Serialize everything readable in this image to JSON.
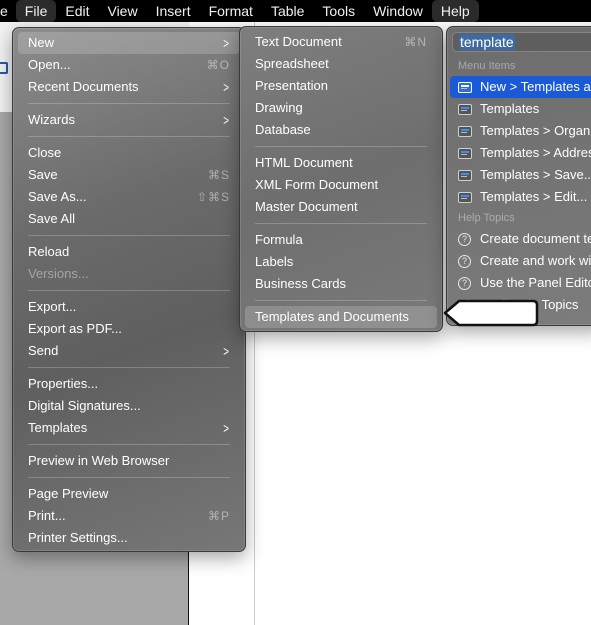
{
  "menubar": {
    "items": [
      {
        "label": "e",
        "open": false
      },
      {
        "label": "File",
        "open": true
      },
      {
        "label": "Edit",
        "open": false
      },
      {
        "label": "View",
        "open": false
      },
      {
        "label": "Insert",
        "open": false
      },
      {
        "label": "Format",
        "open": false
      },
      {
        "label": "Table",
        "open": false
      },
      {
        "label": "Tools",
        "open": false
      },
      {
        "label": "Window",
        "open": false
      },
      {
        "label": "Help",
        "open": true
      }
    ]
  },
  "file_menu": {
    "items": [
      {
        "label": "New",
        "submenu": true,
        "highlighted": true
      },
      {
        "label": "Open...",
        "shortcut": "⌘O"
      },
      {
        "label": "Recent Documents",
        "submenu": true
      },
      {
        "separator": true
      },
      {
        "label": "Wizards",
        "submenu": true
      },
      {
        "separator": true
      },
      {
        "label": "Close"
      },
      {
        "label": "Save",
        "shortcut": "⌘S"
      },
      {
        "label": "Save As...",
        "shortcut": "⇧⌘S"
      },
      {
        "label": "Save All"
      },
      {
        "separator": true
      },
      {
        "label": "Reload"
      },
      {
        "label": "Versions...",
        "disabled": true
      },
      {
        "separator": true
      },
      {
        "label": "Export..."
      },
      {
        "label": "Export as PDF..."
      },
      {
        "label": "Send",
        "submenu": true
      },
      {
        "separator": true
      },
      {
        "label": "Properties..."
      },
      {
        "label": "Digital Signatures..."
      },
      {
        "label": "Templates",
        "submenu": true
      },
      {
        "separator": true
      },
      {
        "label": "Preview in Web Browser"
      },
      {
        "separator": true
      },
      {
        "label": "Page Preview"
      },
      {
        "label": "Print...",
        "shortcut": "⌘P"
      },
      {
        "label": "Printer Settings..."
      }
    ]
  },
  "new_submenu": {
    "items": [
      {
        "label": "Text Document",
        "shortcut": "⌘N"
      },
      {
        "label": "Spreadsheet"
      },
      {
        "label": "Presentation"
      },
      {
        "label": "Drawing"
      },
      {
        "label": "Database"
      },
      {
        "separator": true
      },
      {
        "label": "HTML Document"
      },
      {
        "label": "XML Form Document"
      },
      {
        "label": "Master Document"
      },
      {
        "separator": true
      },
      {
        "label": "Formula"
      },
      {
        "label": "Labels"
      },
      {
        "label": "Business Cards"
      },
      {
        "separator": true
      },
      {
        "label": "Templates and Documents",
        "highlighted": true
      }
    ]
  },
  "help_menu": {
    "search_value": "template",
    "menu_items_header": "Menu Items",
    "menu_items": [
      {
        "label": "New > Templates and Documents",
        "selected": true,
        "icon": "menu-item-icon"
      },
      {
        "label": "Templates",
        "icon": "menu-item-icon"
      },
      {
        "label": "Templates > Organize...",
        "icon": "menu-item-icon"
      },
      {
        "label": "Templates > Address Book Source...",
        "icon": "menu-item-icon"
      },
      {
        "label": "Templates > Save...",
        "icon": "menu-item-icon"
      },
      {
        "label": "Templates > Edit...",
        "icon": "menu-item-icon"
      }
    ],
    "help_topics_header": "Help Topics",
    "help_topics": [
      {
        "label": "Create document templates",
        "icon": "question-circle-icon"
      },
      {
        "label": "Create and work with templates",
        "icon": "question-circle-icon"
      },
      {
        "label": "Use the Panel Editor",
        "icon": "question-circle-icon"
      },
      {
        "label": "Show All Help Topics",
        "icon": ""
      }
    ]
  },
  "colors": {
    "selection_blue": "#1b5ad6",
    "search_highlight": "#3f6aa0",
    "menubar_bg": "#000000"
  }
}
